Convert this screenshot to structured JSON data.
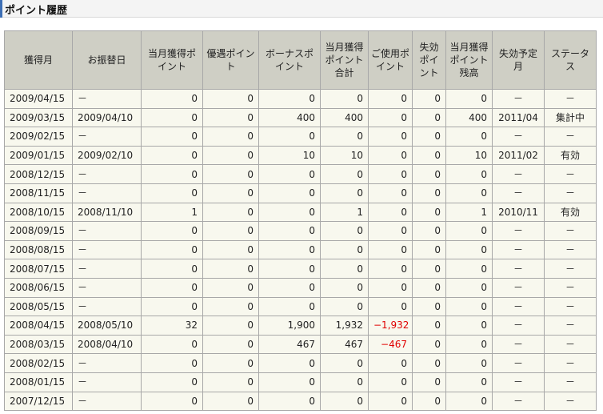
{
  "page": {
    "title": "ポイント履歴"
  },
  "table": {
    "headers": [
      "獲得月",
      "お振替日",
      "当月獲得ポイント",
      "優遇ポイント",
      "ボーナスポイント",
      "当月獲得ポイント合計",
      "ご使用ポイント",
      "失効ポイント",
      "当月獲得ポイント残高",
      "失効予定月",
      "ステータス"
    ],
    "rows": [
      [
        "2009/04/15",
        "－",
        "0",
        "0",
        "0",
        "0",
        "0",
        "0",
        "0",
        "－",
        "－"
      ],
      [
        "2009/03/15",
        "2009/04/10",
        "0",
        "0",
        "400",
        "400",
        "0",
        "0",
        "400",
        "2011/04",
        "集計中"
      ],
      [
        "2009/02/15",
        "－",
        "0",
        "0",
        "0",
        "0",
        "0",
        "0",
        "0",
        "－",
        "－"
      ],
      [
        "2009/01/15",
        "2009/02/10",
        "0",
        "0",
        "10",
        "10",
        "0",
        "0",
        "10",
        "2011/02",
        "有効"
      ],
      [
        "2008/12/15",
        "－",
        "0",
        "0",
        "0",
        "0",
        "0",
        "0",
        "0",
        "－",
        "－"
      ],
      [
        "2008/11/15",
        "－",
        "0",
        "0",
        "0",
        "0",
        "0",
        "0",
        "0",
        "－",
        "－"
      ],
      [
        "2008/10/15",
        "2008/11/10",
        "1",
        "0",
        "0",
        "1",
        "0",
        "0",
        "1",
        "2010/11",
        "有効"
      ],
      [
        "2008/09/15",
        "－",
        "0",
        "0",
        "0",
        "0",
        "0",
        "0",
        "0",
        "－",
        "－"
      ],
      [
        "2008/08/15",
        "－",
        "0",
        "0",
        "0",
        "0",
        "0",
        "0",
        "0",
        "－",
        "－"
      ],
      [
        "2008/07/15",
        "－",
        "0",
        "0",
        "0",
        "0",
        "0",
        "0",
        "0",
        "－",
        "－"
      ],
      [
        "2008/06/15",
        "－",
        "0",
        "0",
        "0",
        "0",
        "0",
        "0",
        "0",
        "－",
        "－"
      ],
      [
        "2008/05/15",
        "－",
        "0",
        "0",
        "0",
        "0",
        "0",
        "0",
        "0",
        "－",
        "－"
      ],
      [
        "2008/04/15",
        "2008/05/10",
        "32",
        "0",
        "1,900",
        "1,932",
        "−1,932",
        "0",
        "0",
        "－",
        "－"
      ],
      [
        "2008/03/15",
        "2008/04/10",
        "0",
        "0",
        "467",
        "467",
        "−467",
        "0",
        "0",
        "－",
        "－"
      ],
      [
        "2008/02/15",
        "－",
        "0",
        "0",
        "0",
        "0",
        "0",
        "0",
        "0",
        "－",
        "－"
      ],
      [
        "2008/01/15",
        "－",
        "0",
        "0",
        "0",
        "0",
        "0",
        "0",
        "0",
        "－",
        "－"
      ],
      [
        "2007/12/15",
        "－",
        "0",
        "0",
        "0",
        "0",
        "0",
        "0",
        "0",
        "－",
        "－"
      ]
    ]
  },
  "colors": {
    "header_bg": "#cfcfc5",
    "cell_bg": "#f8f8ee",
    "border": "#a8a8a8",
    "negative": "#e00000",
    "accent": "#3d6fb5"
  }
}
